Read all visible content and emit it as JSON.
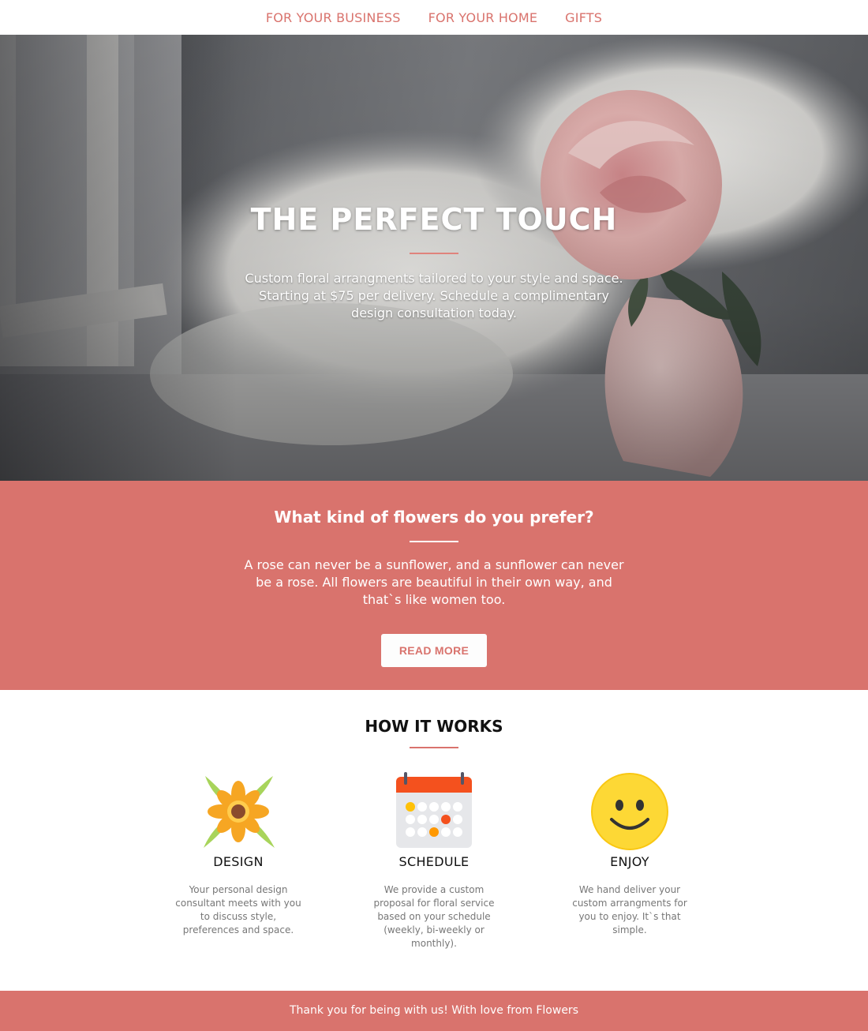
{
  "nav": {
    "items": [
      "FOR YOUR BUSINESS",
      "FOR YOUR HOME",
      "GIFTS"
    ]
  },
  "hero": {
    "title": "THE PERFECT TOUCH",
    "text": "Custom floral arrangments tailored to your style and space. Starting at $75 per delivery. Schedule a complimentary design consultation today."
  },
  "prefer": {
    "title": "What kind of flowers do you prefer?",
    "text": "A rose can never be a sunflower, and a sunflower can never be a rose. All flowers are beautiful in their own way, and that`s like women too.",
    "button_label": "READ MORE"
  },
  "how": {
    "title": "HOW IT WORKS",
    "steps": [
      {
        "icon": "flower-icon",
        "title": "DESIGN",
        "text": "Your personal design consultant meets with you to discuss style, preferences and space."
      },
      {
        "icon": "calendar-icon",
        "title": "SCHEDULE",
        "text": "We provide a custom proposal for floral service based on your schedule (weekly, bi-weekly or monthly)."
      },
      {
        "icon": "smiley-icon",
        "title": "ENJOY",
        "text": "We hand deliver your custom arrangments for you to enjoy. It`s that simple."
      }
    ]
  },
  "footer": {
    "text": "Thank you for being with us! With love from Flowers"
  },
  "colors": {
    "accent": "#d9736d",
    "white": "#ffffff"
  }
}
